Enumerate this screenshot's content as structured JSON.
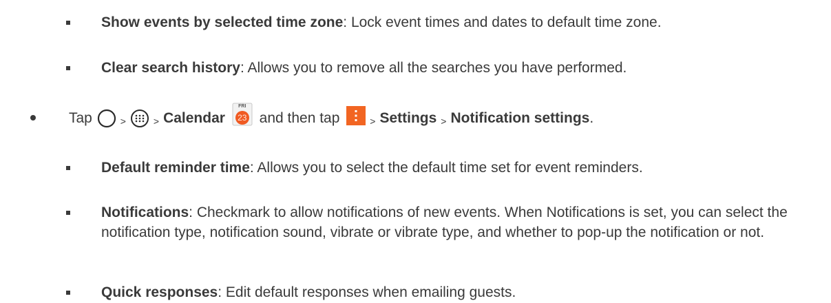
{
  "items": [
    {
      "term": "Show events by selected time zone",
      "desc": ": Lock event times and dates to default time zone."
    },
    {
      "term": "Clear search history",
      "desc": ": Allows you to remove all the searches you have performed."
    }
  ],
  "tap_line": {
    "tap": "Tap",
    "sep": ">",
    "calendar": "Calendar",
    "calendar_icon_day": "FRI",
    "calendar_icon_date": "23",
    "and_then_tap": "and then tap",
    "settings": "Settings",
    "notification_settings": "Notification settings",
    "period": "."
  },
  "sub_items": [
    {
      "term": "Default reminder time",
      "desc": ": Allows you to select the default time set for event reminders."
    },
    {
      "term": "Notifications",
      "desc": ": Checkmark to allow notifications of new events. When Notifications is set, you can select the notification type, notification sound, vibrate or vibrate type, and whether to pop-up the notification or not."
    },
    {
      "term": "Quick responses",
      "desc": ": Edit default responses when emailing guests."
    }
  ],
  "colors": {
    "text": "#3a3a3a",
    "calendar_icon": "#f05a22",
    "menu_icon": "#f26522"
  },
  "icons": [
    "home-icon",
    "apps-icon",
    "calendar-app-icon",
    "menu-icon"
  ]
}
